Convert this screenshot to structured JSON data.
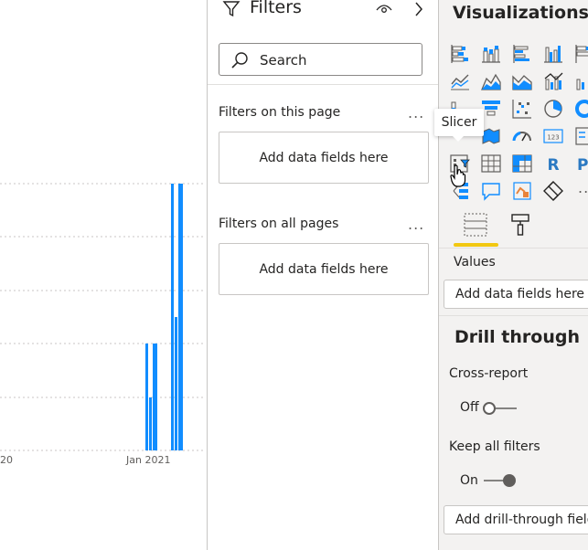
{
  "canvas": {
    "chart_data": {
      "type": "bar",
      "x_tick_labels": [
        "20",
        "Jan 2021"
      ],
      "series": [
        {
          "color": "#118dff"
        }
      ],
      "grid": true,
      "bars_note_values": [
        {
          "x": "Jan 2021 early",
          "values": [
            30,
            20,
            30
          ]
        },
        {
          "x": "Jan 2021 late",
          "values": [
            50,
            25,
            50
          ]
        }
      ]
    }
  },
  "filters": {
    "title": "Filters",
    "search_placeholder": "Search",
    "on_this_page_label": "Filters on this page",
    "on_this_page_drop": "Add data fields here",
    "on_all_pages_label": "Filters on all pages",
    "on_all_pages_drop": "Add data fields here",
    "ellipsis": "..."
  },
  "viz": {
    "title": "Visualizations",
    "tooltip": "Slicer",
    "more": "...",
    "values_label": "Values",
    "values_drop": "Add data fields here",
    "drill_title": "Drill through",
    "cross_report_label": "Cross-report",
    "cross_report_state": "Off",
    "keep_filters_label": "Keep all filters",
    "keep_filters_state": "On",
    "drill_drop": "Add drill-through fields here",
    "icons": [
      "stacked-bar-icon",
      "stacked-column-icon",
      "clustered-bar-icon",
      "clustered-column-icon",
      "100-bar-icon",
      "line-chart-icon",
      "area-chart-icon",
      "stacked-area-icon",
      "line-column-icon",
      "line-column-2-icon",
      "ribbon-icon",
      "funnel-icon",
      "scatter-icon",
      "pie-icon",
      "donut-icon",
      "treemap-icon",
      "map-icon",
      "gauge-icon",
      "card-icon",
      "multi-row-card-icon",
      "slicer-icon",
      "table-icon",
      "matrix-icon",
      "r-visual-icon",
      "python-visual-icon",
      "decomposition-tree-icon",
      "qa-icon",
      "key-influencers-icon",
      "power-apps-icon",
      "more-icon"
    ],
    "accent": "#f2c811"
  }
}
